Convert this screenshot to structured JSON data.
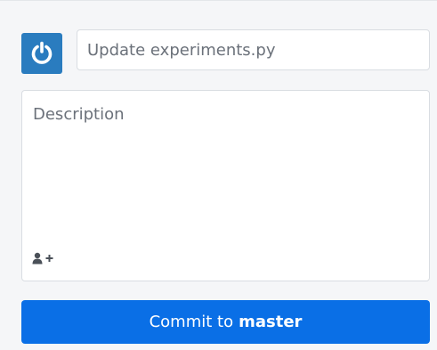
{
  "author": {
    "avatar_icon": "power-icon",
    "avatar_color": "#2a7cbf"
  },
  "summary": {
    "value": "",
    "placeholder": "Update experiments.py"
  },
  "description": {
    "value": "",
    "placeholder": "Description",
    "coauthor_icon": "add-user-icon"
  },
  "commit_button": {
    "prefix": "Commit to",
    "branch": "master",
    "color": "#0a6fe6"
  }
}
